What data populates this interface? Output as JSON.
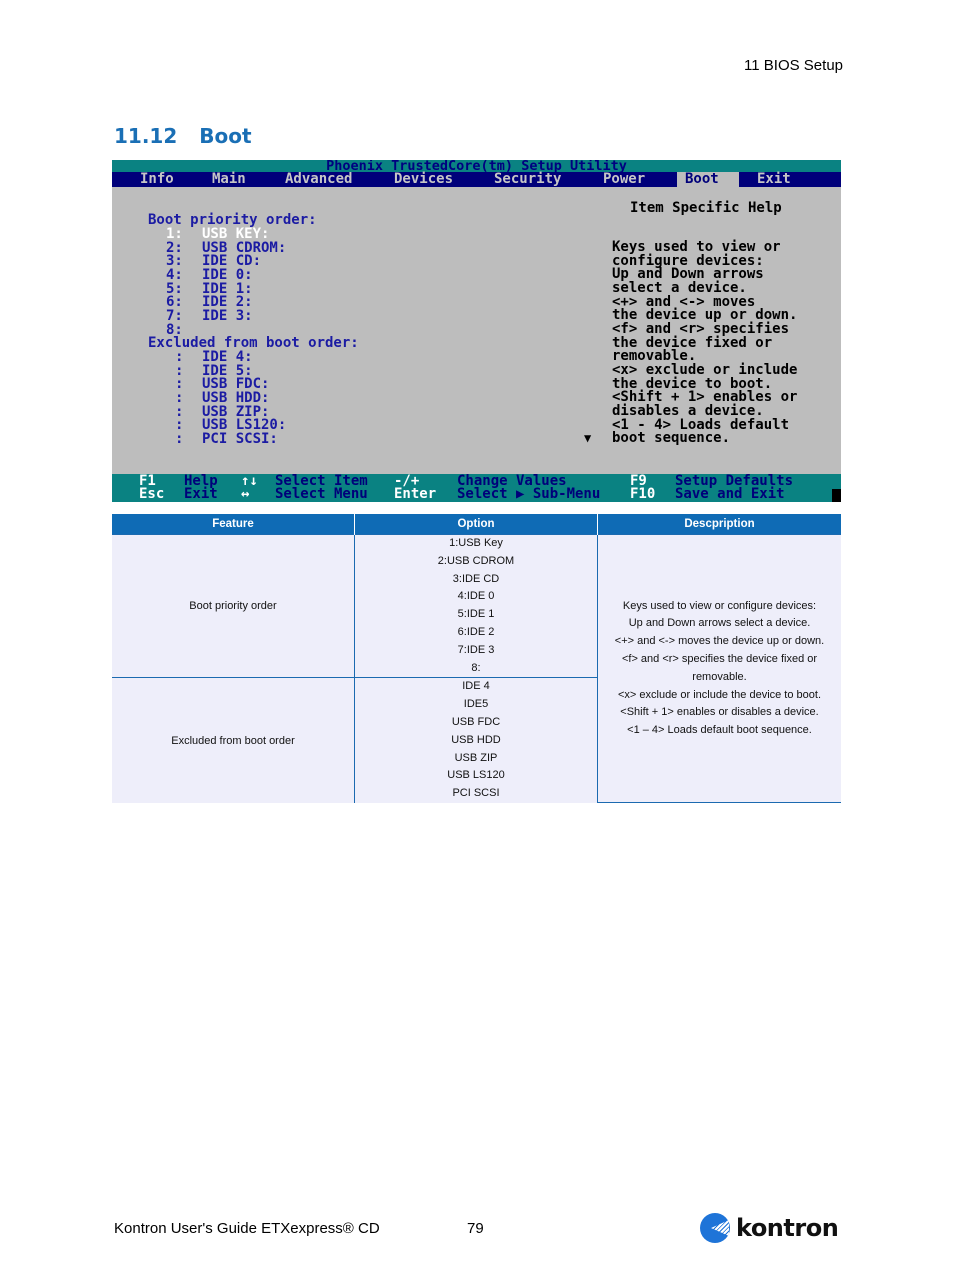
{
  "header": {
    "chapter": "11 BIOS Setup",
    "section_number": "11.12",
    "section_title": "Boot"
  },
  "bios": {
    "title": "Phoenix TrustedCore(tm) Setup Utility",
    "menu": [
      {
        "label": "Info",
        "active": false
      },
      {
        "label": "Main",
        "active": false
      },
      {
        "label": "Advanced",
        "active": false
      },
      {
        "label": "Devices",
        "active": false
      },
      {
        "label": "Security",
        "active": false
      },
      {
        "label": "Power",
        "active": false
      },
      {
        "label": "Boot",
        "active": true
      },
      {
        "label": "Exit",
        "active": false
      }
    ],
    "boot_priority_heading": "Boot priority order:",
    "boot_priority": [
      {
        "index": "1:",
        "device": "USB KEY:"
      },
      {
        "index": "2:",
        "device": "USB CDROM:"
      },
      {
        "index": "3:",
        "device": "IDE CD:"
      },
      {
        "index": "4:",
        "device": "IDE 0:"
      },
      {
        "index": "5:",
        "device": "IDE 1:"
      },
      {
        "index": "6:",
        "device": "IDE 2:"
      },
      {
        "index": "7:",
        "device": "IDE 3:"
      },
      {
        "index": "8:",
        "device": ""
      }
    ],
    "excluded_heading": "Excluded from boot order:",
    "excluded": [
      {
        "index": ":",
        "device": "IDE 4:"
      },
      {
        "index": ":",
        "device": "IDE 5:"
      },
      {
        "index": ":",
        "device": "USB FDC:"
      },
      {
        "index": ":",
        "device": "USB HDD:"
      },
      {
        "index": ":",
        "device": "USB ZIP:"
      },
      {
        "index": ":",
        "device": "USB LS120:"
      },
      {
        "index": ":",
        "device": "PCI SCSI:"
      }
    ],
    "help_title": "Item Specific Help",
    "help_lines": [
      "Keys used to view or",
      "configure devices:",
      "Up and Down arrows",
      "select a device.",
      "<+> and <-> moves",
      "the device up or down.",
      "<f> and <r> specifies",
      "the device fixed or",
      "removable.",
      "<x> exclude or include",
      "the device to boot.",
      "<Shift + 1> enables or",
      "disables a device.",
      "<1 - 4> Loads default",
      "boot sequence."
    ],
    "scroll_down_icon": "▼",
    "footer": {
      "f1_key": "F1",
      "f1_desc": "Help",
      "updown_key": "↑↓",
      "updown_desc": "Select Item",
      "minusplus_key": "-/+",
      "minusplus_desc": "Change Values",
      "f9_key": "F9",
      "f9_desc": "Setup Defaults",
      "esc_key": "Esc",
      "esc_desc": "Exit",
      "leftright_key": "↔",
      "leftright_desc": "Select Menu",
      "enter_key": "Enter",
      "enter_desc": "Select ▶ Sub-Menu",
      "f10_key": "F10",
      "f10_desc": "Save and Exit"
    }
  },
  "table": {
    "headers": [
      "Feature",
      "Option",
      "Descpription"
    ],
    "rows": [
      {
        "feature": "Boot priority order",
        "options": [
          "1:USB Key",
          "2:USB CDROM",
          "3:IDE CD",
          "4:IDE 0",
          "5:IDE 1",
          "6:IDE 2",
          "7:IDE 3",
          "8:"
        ]
      },
      {
        "feature": "Excluded from boot order",
        "options": [
          "IDE 4",
          "IDE5",
          "USB FDC",
          "USB HDD",
          "USB ZIP",
          "USB LS120",
          "PCI SCSI"
        ]
      }
    ],
    "description_lines": [
      "Keys used to view or configure devices:",
      "Up and Down arrows select a device.",
      "<+> and <-> moves the device up or down.",
      "<f> and <r> specifies the device fixed or",
      "removable.",
      "<x> exclude or include the device to boot.",
      "<Shift + 1> enables or disables a device.",
      "<1 – 4> Loads default boot sequence."
    ]
  },
  "footer": {
    "guide_title": "Kontron User's Guide ETXexpress® CD",
    "page_number": "79",
    "logo_text": "kontron"
  }
}
